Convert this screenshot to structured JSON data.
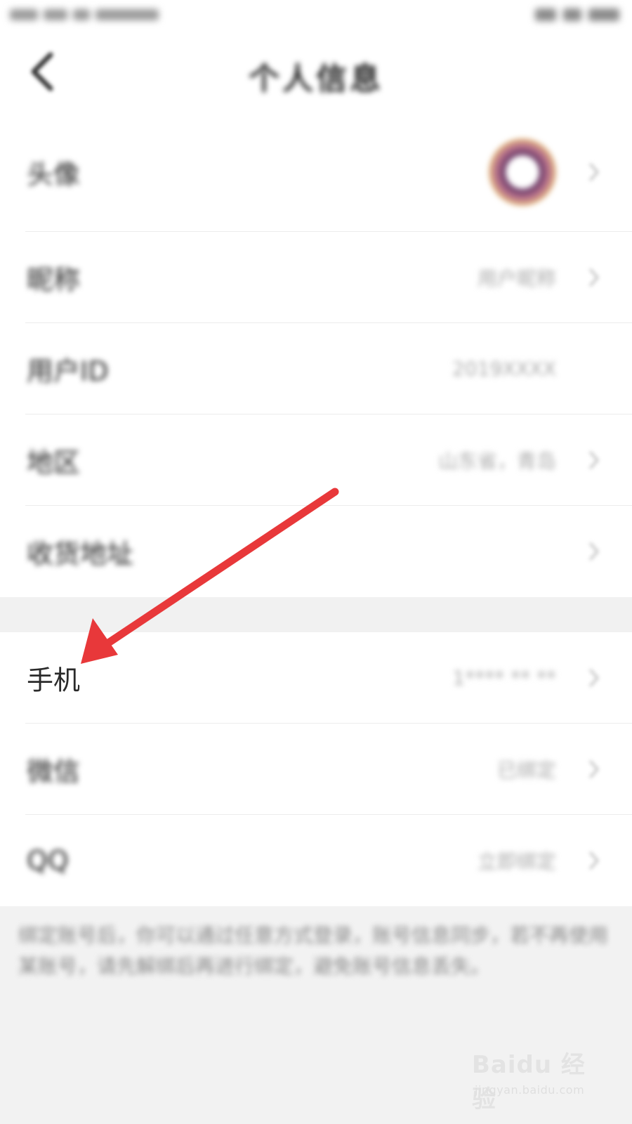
{
  "header": {
    "title": "个人信息"
  },
  "profile_rows": [
    {
      "label": "头像",
      "value": ""
    },
    {
      "label": "昵称",
      "value": "用户昵称"
    },
    {
      "label": "用户ID",
      "value": "2019XXXX"
    },
    {
      "label": "地区",
      "value": "山东省，青岛"
    },
    {
      "label": "收货地址",
      "value": ""
    }
  ],
  "account_rows": [
    {
      "label": "手机",
      "value": "1**** ** **"
    },
    {
      "label": "微信",
      "value": "已绑定"
    },
    {
      "label": "QQ",
      "value": "立即绑定"
    }
  ],
  "footer_note": "绑定账号后，你可以通过任意方式登录，账号信息同步，若不再使用某账号，请先解绑后再进行绑定，避免账号信息丢失。",
  "annotation": {
    "arrow_color": "#e8383a",
    "target": "手机"
  },
  "watermark": {
    "brand": "Baidu 经验",
    "url": "jingyan.baidu.com"
  },
  "colors": {
    "background": "#f2f2f2",
    "card": "#ffffff",
    "label_text": "#222222",
    "value_text": "#aaaaaa"
  }
}
